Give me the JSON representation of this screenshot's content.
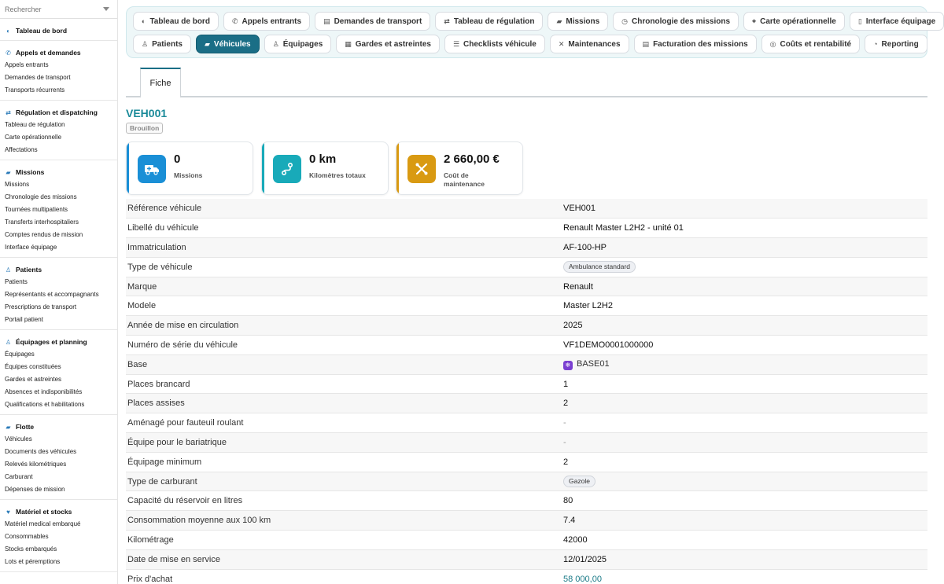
{
  "sidebar": {
    "search_placeholder": "Rechercher",
    "sections": [
      {
        "title": "Tableau de bord",
        "icon": "dashboard-icon",
        "items": []
      },
      {
        "title": "Appels et demandes",
        "icon": "phone-icon",
        "items": [
          "Appels entrants",
          "Demandes de transport",
          "Transports récurrents"
        ]
      },
      {
        "title": "Régulation et dispatching",
        "icon": "shuffle-icon",
        "items": [
          "Tableau de régulation",
          "Carte opérationnelle",
          "Affectations"
        ]
      },
      {
        "title": "Missions",
        "icon": "ambulance-icon",
        "items": [
          "Missions",
          "Chronologie des missions",
          "Tournées multipatients",
          "Transferts interhospitaliers",
          "Comptes rendus de mission",
          "Interface équipage"
        ]
      },
      {
        "title": "Patients",
        "icon": "user-icon",
        "items": [
          "Patients",
          "Représentants et accompagnants",
          "Prescriptions de transport",
          "Portail patient"
        ]
      },
      {
        "title": "Équipages et planning",
        "icon": "team-icon",
        "items": [
          "Équipages",
          "Équipes constituées",
          "Gardes et astreintes",
          "Absences et indisponibilités",
          "Qualifications et habilitations"
        ]
      },
      {
        "title": "Flotte",
        "icon": "truck-icon",
        "items": [
          "Véhicules",
          "Documents des véhicules",
          "Relevés kilométriques",
          "Carburant",
          "Dépenses de mission"
        ]
      },
      {
        "title": "Matériel et stocks",
        "icon": "heart-icon",
        "items": [
          "Matériel medical embarqué",
          "Consommables",
          "Stocks embarqués",
          "Lots et péremptions"
        ]
      }
    ]
  },
  "topnav": {
    "row1": [
      {
        "label": "Tableau de bord",
        "icon": "dashboard-icon",
        "glyph": "◐"
      },
      {
        "label": "Appels entrants",
        "icon": "phone-icon",
        "glyph": "✆"
      },
      {
        "label": "Demandes de transport",
        "icon": "document-icon",
        "glyph": "▤"
      },
      {
        "label": "Tableau de régulation",
        "icon": "shuffle-icon",
        "glyph": "⇄"
      },
      {
        "label": "Missions",
        "icon": "ambulance-icon",
        "glyph": "▰"
      },
      {
        "label": "Chronologie des missions",
        "icon": "clock-icon",
        "glyph": "◷"
      },
      {
        "label": "Carte opérationnelle",
        "icon": "map-icon",
        "glyph": "⌖"
      },
      {
        "label": "Interface équipage",
        "icon": "mobile-icon",
        "glyph": "▯"
      }
    ],
    "row2": [
      {
        "label": "Patients",
        "icon": "user-icon",
        "glyph": "♙",
        "active": false
      },
      {
        "label": "Véhicules",
        "icon": "truck-icon",
        "glyph": "▰",
        "active": true
      },
      {
        "label": "Équipages",
        "icon": "team-icon",
        "glyph": "♙",
        "active": false
      },
      {
        "label": "Gardes et astreintes",
        "icon": "calendar-icon",
        "glyph": "▦",
        "active": false
      },
      {
        "label": "Checklists véhicule",
        "icon": "list-icon",
        "glyph": "☰",
        "active": false
      },
      {
        "label": "Maintenances",
        "icon": "tools-icon",
        "glyph": "✕",
        "active": false
      },
      {
        "label": "Facturation des missions",
        "icon": "invoice-icon",
        "glyph": "▤",
        "active": false
      },
      {
        "label": "Coûts et rentabilité",
        "icon": "coins-icon",
        "glyph": "◎",
        "active": false
      },
      {
        "label": "Reporting",
        "icon": "pie-chart-icon",
        "glyph": "◔",
        "active": false
      }
    ]
  },
  "form": {
    "tab_label": "Fiche",
    "title": "VEH001",
    "status": "Brouillon"
  },
  "kpis": [
    {
      "value": "0",
      "label": "Missions",
      "icon": "ambulance-icon",
      "color": "#1a8fd6"
    },
    {
      "value": "0 km",
      "label": "Kilomètres totaux",
      "icon": "route-icon",
      "color": "#18aab9"
    },
    {
      "value": "2 660,00 €",
      "label": "Coût de maintenance",
      "icon": "tools-icon",
      "color": "#d99a12"
    }
  ],
  "properties": [
    {
      "key": "Référence véhicule",
      "value": "VEH001",
      "type": "text"
    },
    {
      "key": "Libellé du véhicule",
      "value": "Renault Master L2H2 - unité 01",
      "type": "text"
    },
    {
      "key": "Immatriculation",
      "value": "AF-100-HP",
      "type": "text"
    },
    {
      "key": "Type de véhicule",
      "value": "Ambulance standard",
      "type": "pill"
    },
    {
      "key": "Marque",
      "value": "Renault",
      "type": "text"
    },
    {
      "key": "Modele",
      "value": "Master L2H2",
      "type": "text"
    },
    {
      "key": "Année de mise en circulation",
      "value": "2025",
      "type": "text"
    },
    {
      "key": "Numéro de série du véhicule",
      "value": "VF1DEMO0001000000",
      "type": "text"
    },
    {
      "key": "Base",
      "value": "BASE01",
      "type": "base"
    },
    {
      "key": "Places brancard",
      "value": "1",
      "type": "text"
    },
    {
      "key": "Places assises",
      "value": "2",
      "type": "text"
    },
    {
      "key": "Aménagé pour fauteuil roulant",
      "value": "-",
      "type": "dash"
    },
    {
      "key": "Équipe pour le bariatrique",
      "value": "-",
      "type": "dash"
    },
    {
      "key": "Équipage minimum",
      "value": "2",
      "type": "text"
    },
    {
      "key": "Type de carburant",
      "value": "Gazole",
      "type": "pill"
    },
    {
      "key": "Capacité du réservoir en litres",
      "value": "80",
      "type": "text"
    },
    {
      "key": "Consommation moyenne aux 100 km",
      "value": "7.4",
      "type": "text"
    },
    {
      "key": "Kilométrage",
      "value": "42000",
      "type": "text"
    },
    {
      "key": "Date de mise en service",
      "value": "12/01/2025",
      "type": "text"
    },
    {
      "key": "Prix d'achat",
      "value": "58 000,00",
      "type": "link"
    }
  ]
}
